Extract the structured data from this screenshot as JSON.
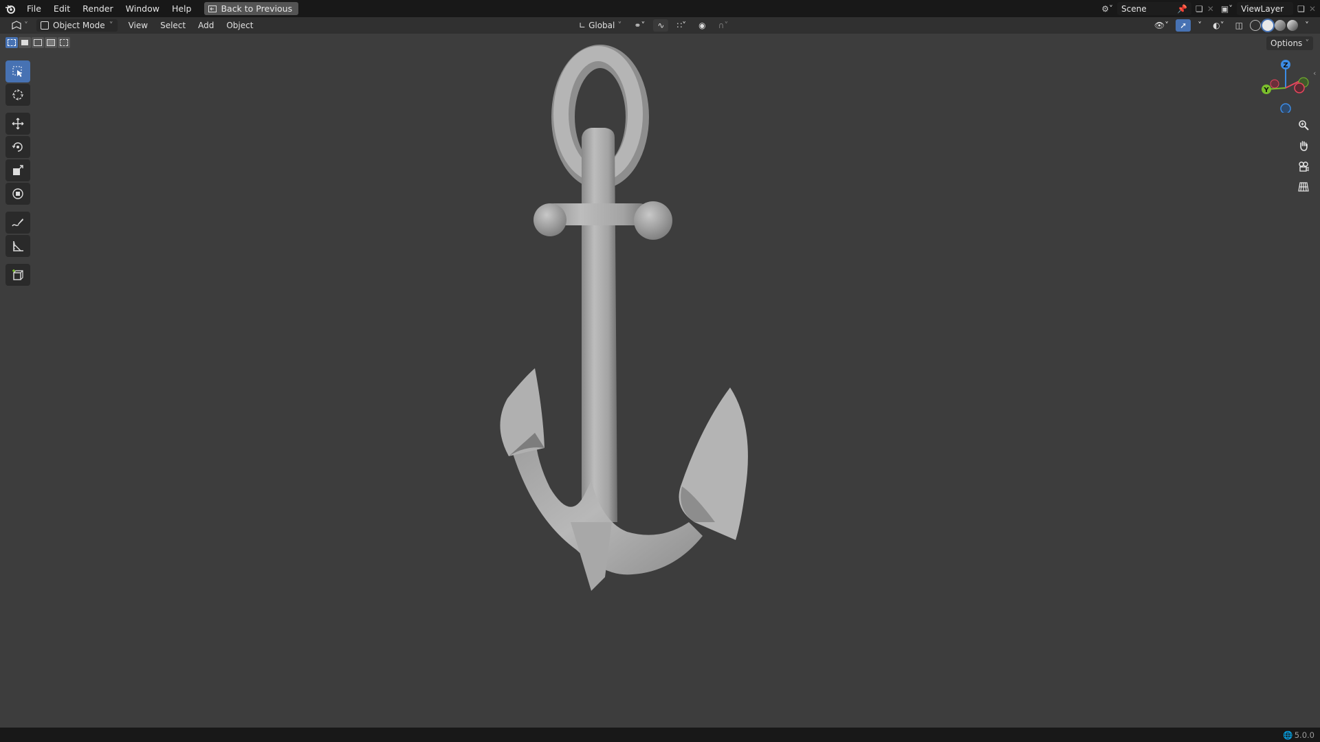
{
  "topbar": {
    "menus": [
      "File",
      "Edit",
      "Render",
      "Window",
      "Help"
    ],
    "back_button": "Back to Previous",
    "scene": "Scene",
    "view_layer": "ViewLayer"
  },
  "header": {
    "mode": "Object Mode",
    "menus": [
      "View",
      "Select",
      "Add",
      "Object"
    ],
    "orientation": "Global"
  },
  "viewport": {
    "options_label": "Options",
    "gizmo_axes": {
      "z": "Z",
      "y": "Y"
    }
  },
  "toolbar": {
    "tools": [
      "select-box",
      "cursor",
      "move",
      "rotate",
      "scale",
      "transform",
      "annotate",
      "measure",
      "add-cube"
    ]
  },
  "statusbar": {
    "version": "5.0.0"
  },
  "colors": {
    "viewport_bg": "#3d3d3d",
    "accent": "#4772b3",
    "axis_x": "#e8465d",
    "axis_y": "#7bbf2c",
    "axis_z": "#3c8ce6"
  }
}
